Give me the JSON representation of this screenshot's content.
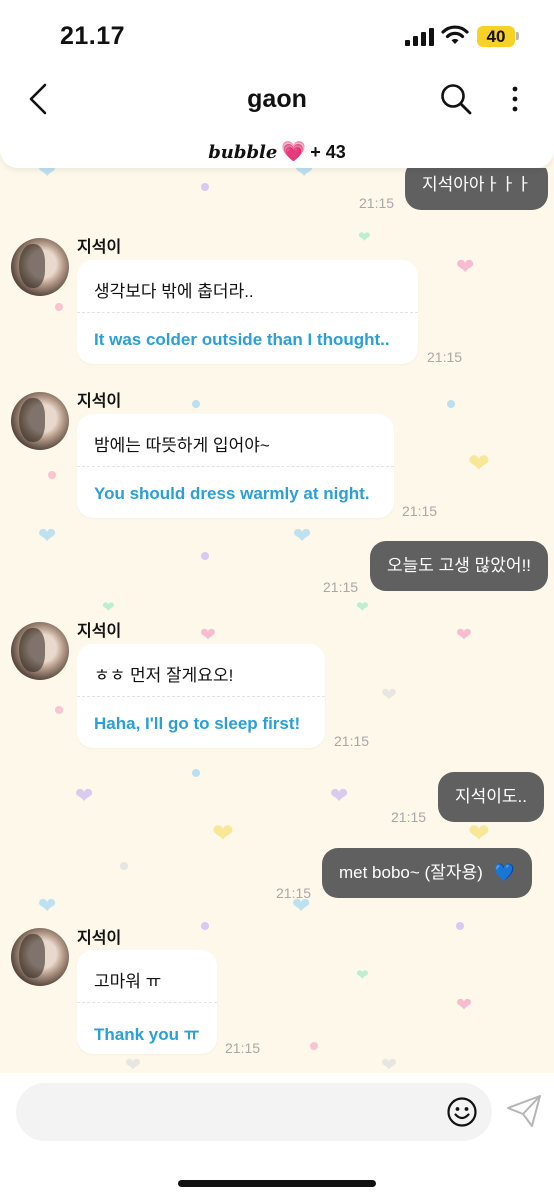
{
  "status_bar": {
    "time": "21.17",
    "battery": "40"
  },
  "header": {
    "title": "gaon",
    "subtitle_brand": "bubble",
    "subtitle_count": "+ 43"
  },
  "messages": [
    {
      "type": "outgoing",
      "text": "지석아아ㅏㅏㅏ",
      "time": "21:15"
    },
    {
      "type": "incoming",
      "sender": "지석이",
      "text": "생각보다 밖에 춥더라..",
      "translation": "It was colder outside than I thought..",
      "time": "21:15"
    },
    {
      "type": "incoming",
      "sender": "지석이",
      "text": "밤에는 따뜻하게 입어야~",
      "translation": "You should dress warmly at night.",
      "time": "21:15"
    },
    {
      "type": "outgoing",
      "text": "오늘도 고생 많았어!!",
      "time": "21:15"
    },
    {
      "type": "incoming",
      "sender": "지석이",
      "text": "ㅎㅎ 먼저 잘게요오!",
      "translation": "Haha, I'll go to sleep first!",
      "time": "21:15"
    },
    {
      "type": "outgoing",
      "text": "지석이도..",
      "time": "21:15"
    },
    {
      "type": "outgoing",
      "text": "met bobo~ (잘자용)",
      "emoji": "💙",
      "time": "21:15"
    },
    {
      "type": "incoming",
      "sender": "지석이",
      "text": "고마워 ㅠ",
      "translation": "Thank you ㅠ",
      "time": "21:15"
    }
  ],
  "input": {
    "placeholder": ""
  },
  "colors": {
    "background": "#fdf8ea",
    "outgoing_bubble": "#606060",
    "translation_text": "#2a9fd8",
    "battery": "#f7d126"
  }
}
